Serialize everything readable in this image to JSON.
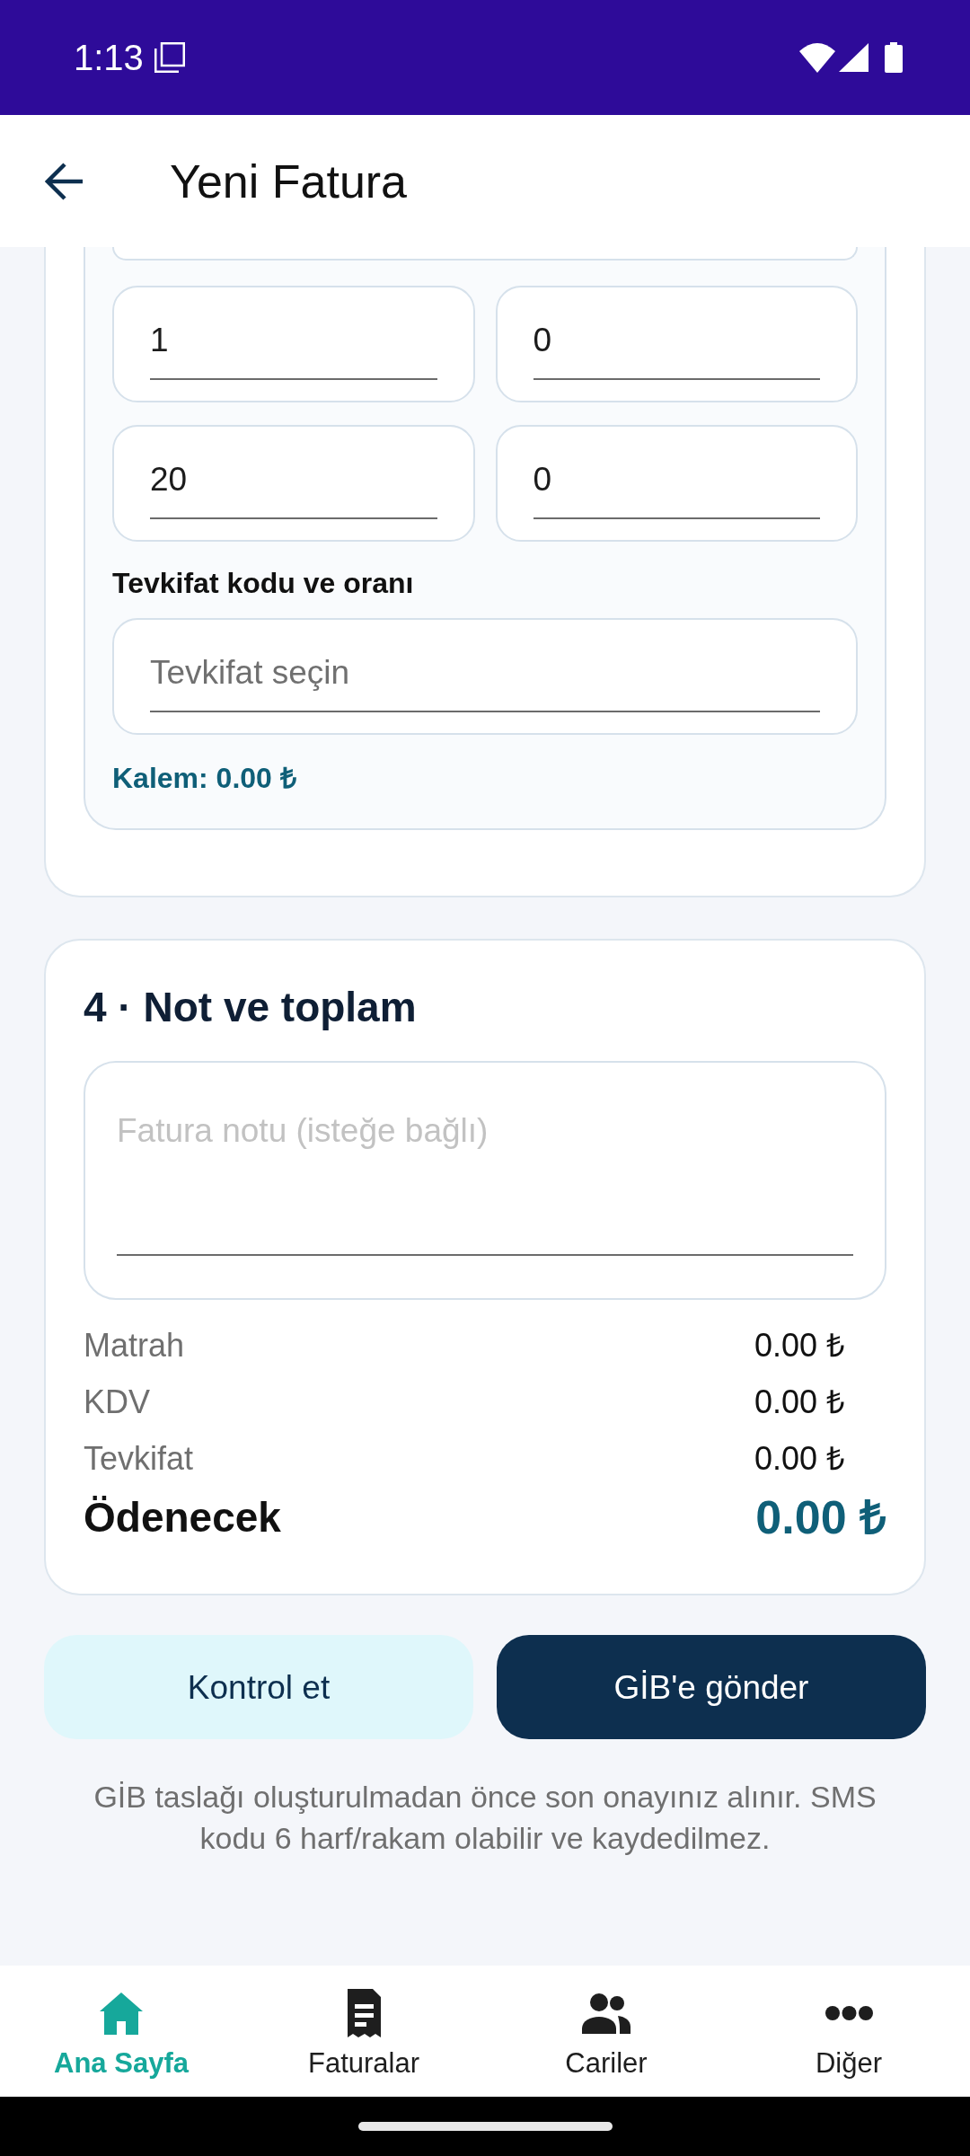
{
  "status_bar": {
    "time": "1:13"
  },
  "app_bar": {
    "title": "Yeni Fatura"
  },
  "item_card": {
    "fields": [
      {
        "value": "1"
      },
      {
        "value": "0"
      },
      {
        "value": "20"
      },
      {
        "value": "0"
      }
    ],
    "withholding": {
      "label": "Tevkifat kodu ve oranı",
      "placeholder": "Tevkifat seçin"
    },
    "line_total": "Kalem: 0.00 ₺"
  },
  "summary": {
    "title": "4 · Not ve toplam",
    "note": {
      "placeholder": "Fatura notu (isteğe bağlı)"
    },
    "rows": [
      {
        "label": "Matrah",
        "value": "0.00 ₺"
      },
      {
        "label": "KDV",
        "value": "0.00 ₺"
      },
      {
        "label": "Tevkifat",
        "value": "0.00 ₺"
      }
    ],
    "total": {
      "label": "Ödenecek",
      "value": "0.00 ₺"
    }
  },
  "buttons": [
    {
      "label": "Kontrol et",
      "kind": "secondary"
    },
    {
      "label": "GİB'e gönder",
      "kind": "primary"
    }
  ],
  "footnote": "GİB taslağı oluşturulmadan önce son onayınız alınır. SMS kodu 6 harf/rakam olabilir ve kaydedilmez.",
  "bottom_nav": [
    {
      "label": "Ana Sayfa",
      "selected": true
    },
    {
      "label": "Faturalar",
      "selected": false
    },
    {
      "label": "Cariler",
      "selected": false
    },
    {
      "label": "Diğer",
      "selected": false
    }
  ]
}
